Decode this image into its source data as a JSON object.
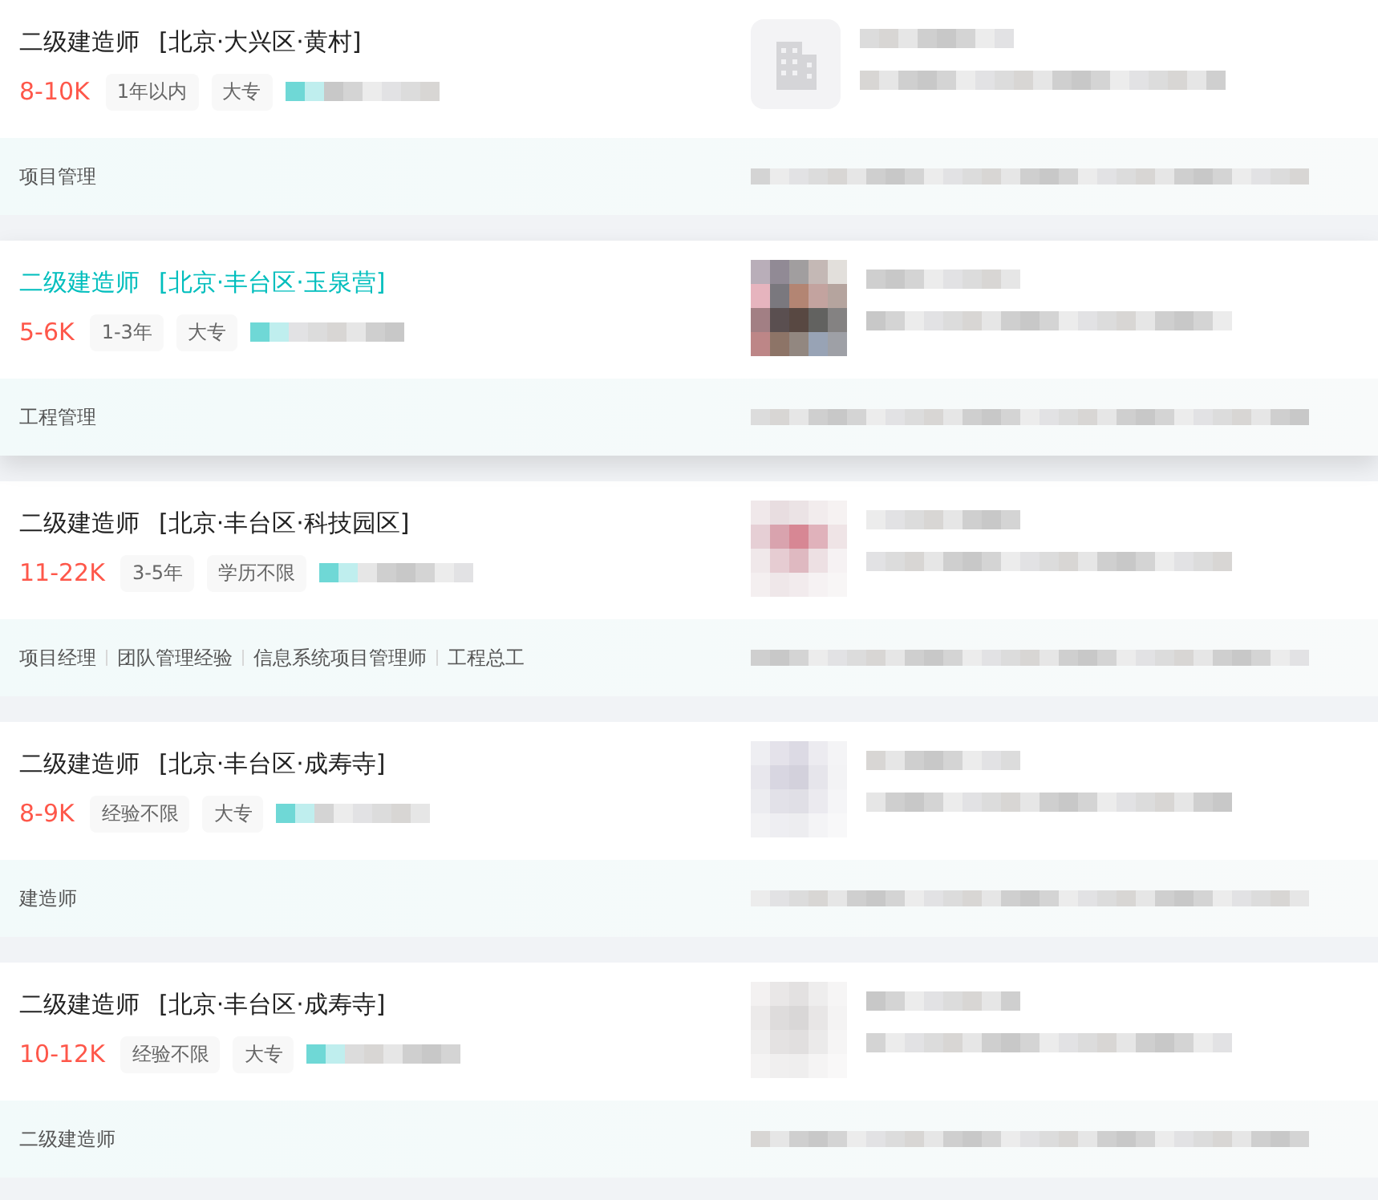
{
  "jobs": [
    {
      "title": "二级建造师",
      "area": "[北京·大兴区·黄村]",
      "salary": "8-10K",
      "tags": [
        "1年以内",
        "大专"
      ],
      "skills": [
        "项目管理"
      ],
      "selected": false,
      "logo": {
        "kind": "building"
      }
    },
    {
      "title": "二级建造师",
      "area": "[北京·丰台区·玉泉营]",
      "salary": "5-6K",
      "tags": [
        "1-3年",
        "大专"
      ],
      "skills": [
        "工程管理"
      ],
      "selected": true,
      "logo": {
        "kind": "picture"
      }
    },
    {
      "title": "二级建造师",
      "area": "[北京·丰台区·科技园区]",
      "salary": "11-22K",
      "tags": [
        "3-5年",
        "学历不限"
      ],
      "skills": [
        "项目经理",
        "团队管理经验",
        "信息系统项目管理师",
        "工程总工"
      ],
      "selected": false,
      "logo": {
        "kind": "picture"
      }
    },
    {
      "title": "二级建造师",
      "area": "[北京·丰台区·成寿寺]",
      "salary": "8-9K",
      "tags": [
        "经验不限",
        "大专"
      ],
      "skills": [
        "建造师"
      ],
      "selected": false,
      "logo": {
        "kind": "picture"
      }
    },
    {
      "title": "二级建造师",
      "area": "[北京·丰台区·成寿寺]",
      "salary": "10-12K",
      "tags": [
        "经验不限",
        "大专"
      ],
      "skills": [
        "二级建造师"
      ],
      "selected": false,
      "logo": {
        "kind": "picture"
      }
    }
  ]
}
